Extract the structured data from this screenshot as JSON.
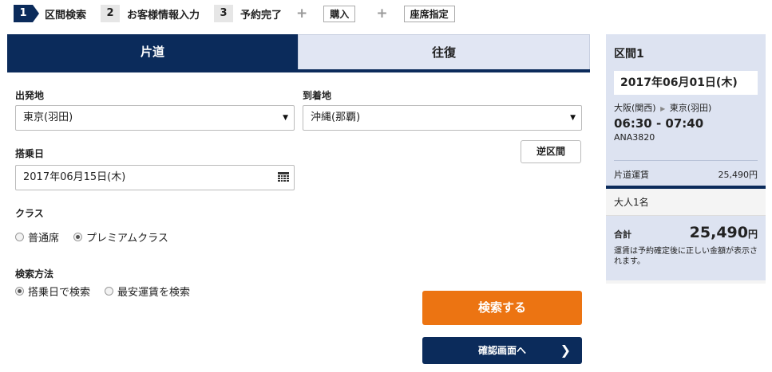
{
  "steps": [
    {
      "num": "1",
      "label": "区間検索"
    },
    {
      "num": "2",
      "label": "お客様情報入力"
    },
    {
      "num": "3",
      "label": "予約完了"
    }
  ],
  "extra_steps": {
    "plus": "+",
    "purchase": "購入",
    "seat": "座席指定"
  },
  "tabs": {
    "one_way": "片道",
    "round_trip": "往復"
  },
  "form": {
    "departure_label": "出発地",
    "departure_value": "東京(羽田)",
    "arrival_label": "到着地",
    "arrival_value": "沖縄(那覇)",
    "date_label": "搭乗日",
    "date_value": "2017年06月15日(木)",
    "reverse_label": "逆区間",
    "class_label": "クラス",
    "class_options": [
      "普通席",
      "プレミアムクラス"
    ],
    "class_selected": "プレミアムクラス",
    "method_label": "検索方法",
    "method_options": [
      "搭乗日で検索",
      "最安運賃を検索"
    ],
    "method_selected": "搭乗日で検索",
    "search_button": "検索する",
    "confirm_button": "確認画面へ"
  },
  "summary": {
    "section_title": "区間1",
    "date": "2017年06月01日(木)",
    "from": "大阪(関西)",
    "to": "東京(羽田)",
    "times": "06:30 - 07:40",
    "flight": "ANA3820",
    "fare_label": "片道運賃",
    "fare_value": "25,490円",
    "passengers": "大人1名",
    "total_label": "合計",
    "total_value": "25,490",
    "total_unit": "円",
    "note": "運賃は予約確定後に正しい金額が表示されます。"
  },
  "colors": {
    "navy": "#0b2b5b",
    "orange": "#ec7412",
    "light_blue": "#dde3f1"
  }
}
